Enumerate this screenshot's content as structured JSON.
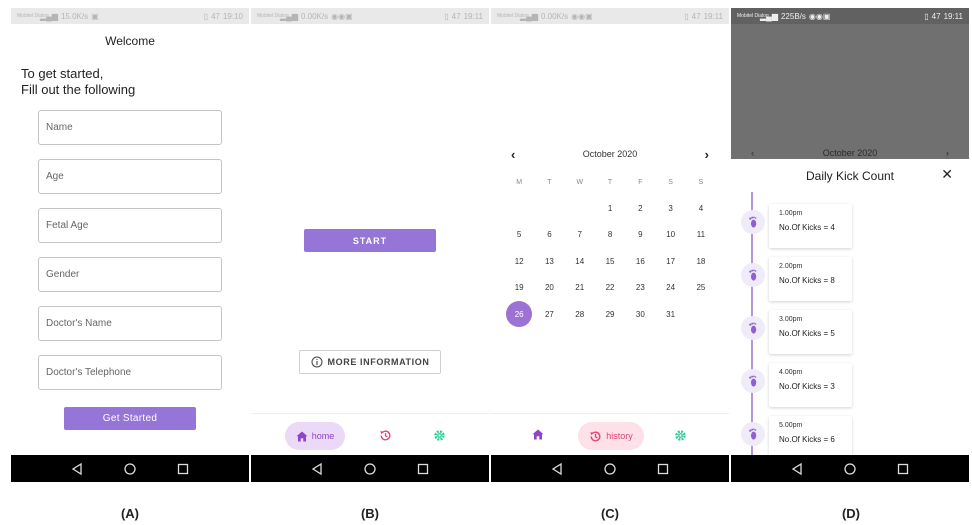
{
  "status_a": {
    "carrier": "Mobitel Dialog",
    "speed": "15.0K/s",
    "battery": "47",
    "time": "19:10"
  },
  "status_b": {
    "carrier": "Mobitel Dialog",
    "speed": "0.00K/s",
    "battery": "47",
    "time": "19:11"
  },
  "status_c": {
    "carrier": "Mobitel Dialog",
    "speed": "0.00K/s",
    "battery": "47",
    "time": "19:11"
  },
  "status_d": {
    "carrier": "Mobitel Dialog",
    "speed": "225B/s",
    "battery": "47",
    "time": "19:11"
  },
  "screen_a": {
    "welcome": "Welcome",
    "intro_line1": "To get started,",
    "intro_line2": "Fill out the following",
    "fields": [
      {
        "placeholder": "Name"
      },
      {
        "placeholder": "Age"
      },
      {
        "placeholder": "Fetal Age"
      },
      {
        "placeholder": "Gender"
      },
      {
        "placeholder": "Doctor's Name"
      },
      {
        "placeholder": "Doctor's Telephone"
      }
    ],
    "button": "Get Started"
  },
  "screen_b": {
    "start_button": "START",
    "more_info_button": "MORE INFORMATION",
    "nav_home_label": "home"
  },
  "screen_c": {
    "month": "October 2020",
    "weekdays": [
      "M",
      "T",
      "W",
      "T",
      "F",
      "S",
      "S"
    ],
    "leading_blanks": 3,
    "days": [
      "1",
      "2",
      "3",
      "4",
      "5",
      "6",
      "7",
      "8",
      "9",
      "10",
      "11",
      "12",
      "13",
      "14",
      "15",
      "16",
      "17",
      "18",
      "19",
      "20",
      "21",
      "22",
      "23",
      "24",
      "25",
      "26",
      "27",
      "28",
      "29",
      "30",
      "31"
    ],
    "selected_day": "26",
    "nav_history_label": "history"
  },
  "screen_d": {
    "month": "October 2020",
    "title": "Daily Kick Count",
    "close": "✕",
    "entries": [
      {
        "time": "1.00pm",
        "count": "No.Of Kicks = 4"
      },
      {
        "time": "2.00pm",
        "count": "No.Of Kicks = 8"
      },
      {
        "time": "3.00pm",
        "count": "No.Of Kicks = 5"
      },
      {
        "time": "4.00pm",
        "count": "No.Of Kicks = 3"
      },
      {
        "time": "5.00pm",
        "count": "No.Of Kicks = 6"
      }
    ]
  },
  "captions": [
    "(A)",
    "(B)",
    "(C)",
    "(D)"
  ],
  "colors": {
    "primary_purple": "#9575d7",
    "home_pill": "#ead9f7",
    "history_pill": "#fde0e8",
    "history_pink": "#e0457a",
    "settings_green": "#2ecc9a"
  },
  "icons": {
    "nav_back": "triangle-back-icon",
    "nav_home": "circle-home-icon",
    "nav_recents": "square-recents-icon",
    "tab_home": "house-icon",
    "tab_history": "history-clock-icon",
    "tab_settings": "gear-icon",
    "info": "info-circle-icon",
    "foot": "baby-foot-icon"
  }
}
